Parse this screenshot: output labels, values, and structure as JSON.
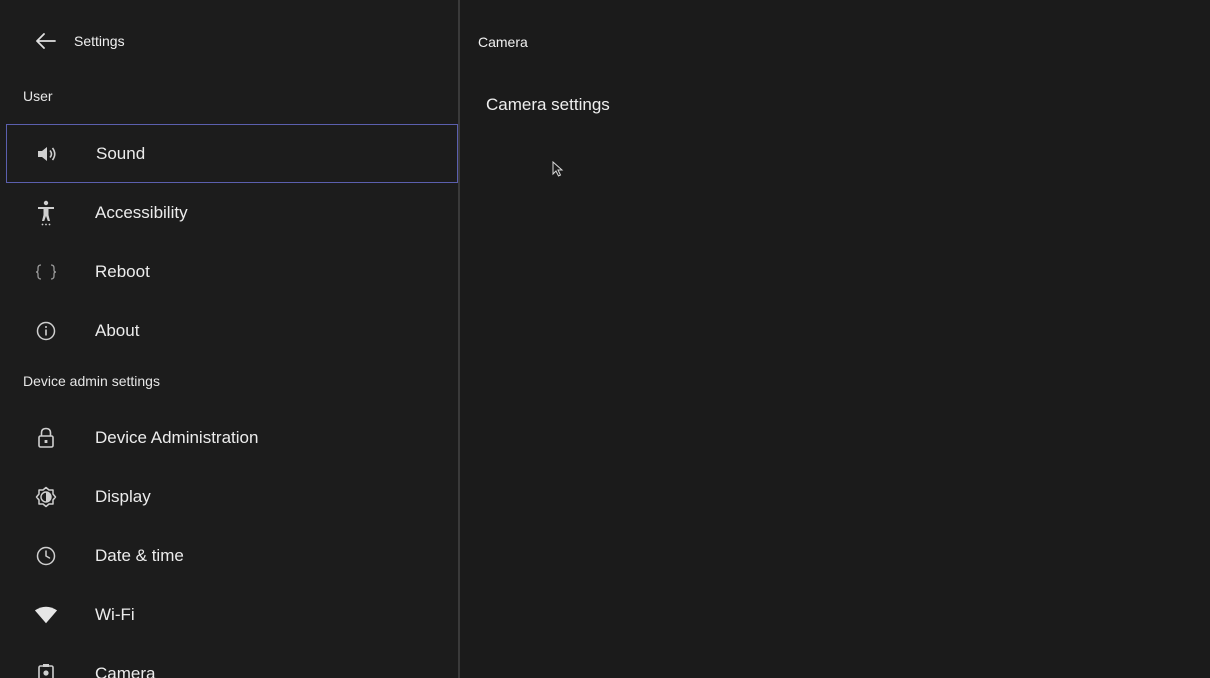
{
  "header": {
    "title": "Settings",
    "back_icon": "arrow-left-icon"
  },
  "sections": {
    "user": "User",
    "device_admin": "Device admin settings"
  },
  "user_items": [
    {
      "label": "Sound",
      "icon": "speaker-icon",
      "selected": true
    },
    {
      "label": "Accessibility",
      "icon": "accessibility-icon"
    },
    {
      "label": "Reboot",
      "icon": "braces-icon"
    },
    {
      "label": "About",
      "icon": "info-icon"
    }
  ],
  "admin_items": [
    {
      "label": "Device Administration",
      "icon": "lock-icon"
    },
    {
      "label": "Display",
      "icon": "brightness-icon"
    },
    {
      "label": "Date & time",
      "icon": "clock-icon"
    },
    {
      "label": "Wi-Fi",
      "icon": "wifi-icon"
    },
    {
      "label": "Camera",
      "icon": "camera-icon"
    }
  ],
  "detail": {
    "title": "Camera",
    "items": [
      {
        "label": "Camera settings"
      }
    ]
  },
  "colors": {
    "selection_border": "#5b5fae",
    "background": "#1b1b1b"
  }
}
